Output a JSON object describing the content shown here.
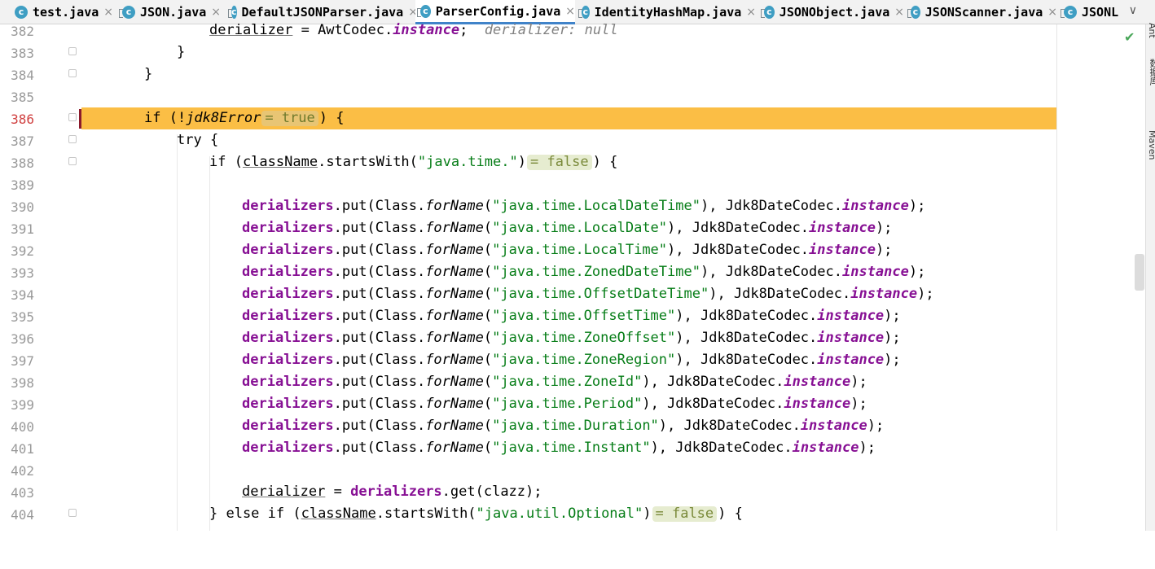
{
  "tabs": [
    {
      "label": "test.java",
      "icon": "class-icon",
      "active": false
    },
    {
      "label": "JSON.java",
      "icon": "library-class-icon",
      "active": false
    },
    {
      "label": "DefaultJSONParser.java",
      "icon": "library-class-icon",
      "active": false
    },
    {
      "label": "ParserConfig.java",
      "icon": "library-class-icon",
      "active": true
    },
    {
      "label": "IdentityHashMap.java",
      "icon": "library-class-icon",
      "active": false
    },
    {
      "label": "JSONObject.java",
      "icon": "library-class-icon",
      "active": false
    },
    {
      "label": "JSONScanner.java",
      "icon": "library-class-icon",
      "active": false
    },
    {
      "label": "JSONL",
      "icon": "library-class-icon",
      "active": false
    }
  ],
  "tab_close_glyph": "×",
  "tab_more_glyph": "∨",
  "side_labels": [
    "Ant",
    "数据库",
    "Maven"
  ],
  "status_check": "✔",
  "current_line": "386",
  "lines": [
    {
      "n": "382"
    },
    {
      "n": "383"
    },
    {
      "n": "384"
    },
    {
      "n": "385"
    },
    {
      "n": "386"
    },
    {
      "n": "387"
    },
    {
      "n": "388"
    },
    {
      "n": "389"
    },
    {
      "n": "390"
    },
    {
      "n": "391"
    },
    {
      "n": "392"
    },
    {
      "n": "393"
    },
    {
      "n": "394"
    },
    {
      "n": "395"
    },
    {
      "n": "396"
    },
    {
      "n": "397"
    },
    {
      "n": "398"
    },
    {
      "n": "399"
    },
    {
      "n": "400"
    },
    {
      "n": "401"
    },
    {
      "n": "402"
    },
    {
      "n": "403"
    },
    {
      "n": "404"
    }
  ],
  "code": {
    "l382_a": "derializer",
    "l382_b": " = AwtCodec.",
    "l382_c": "instance",
    "l382_d": ";",
    "l382_hint": "derializer: null",
    "l383": "}",
    "l384": "}",
    "l386_a": "if (!",
    "l386_b": "jdk8Error",
    "l386_inl": "= true",
    "l386_c": ") {",
    "l387": "try {",
    "l388_a": "if (",
    "l388_b": "className",
    "l388_c": ".startsWith(",
    "l388_s": "\"java.time.\"",
    "l388_d": ")",
    "l388_inl": "= false",
    "l388_e": ") {",
    "put_field": "derializers",
    "put_call": ".put(Class.",
    "put_method": "forName",
    "codec": "Jdk8DateCodec.",
    "inst": "instance",
    "end": ");",
    "puts": [
      "\"java.time.LocalDateTime\"",
      "\"java.time.LocalDate\"",
      "\"java.time.LocalTime\"",
      "\"java.time.ZonedDateTime\"",
      "\"java.time.OffsetDateTime\"",
      "\"java.time.OffsetTime\"",
      "\"java.time.ZoneOffset\"",
      "\"java.time.ZoneRegion\"",
      "\"java.time.ZoneId\"",
      "\"java.time.Period\"",
      "\"java.time.Duration\"",
      "\"java.time.Instant\""
    ],
    "l403_a": "derializer",
    "l403_b": " = ",
    "l403_c": "derializers",
    "l403_d": ".get(clazz);",
    "l404_a": "} else if (",
    "l404_b": "className",
    "l404_c": ".startsWith(",
    "l404_s": "\"java.util.Optional\"",
    "l404_d": ")",
    "l404_inl": "= false",
    "l404_e": ") {"
  }
}
